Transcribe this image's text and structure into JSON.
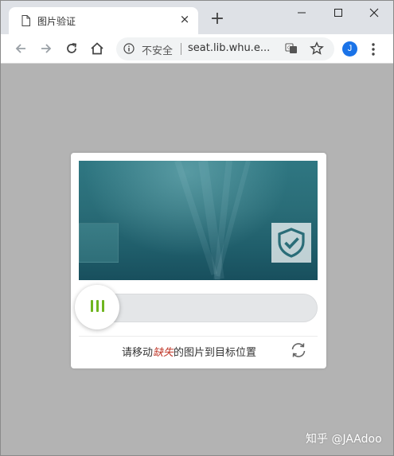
{
  "browser": {
    "tab_title": "图片验证",
    "tab_close": "×",
    "new_tab": "+",
    "window_controls": [
      "minimize-icon",
      "maximize-icon",
      "close-icon"
    ],
    "nav_icons": [
      "back-arrow-icon",
      "forward-arrow-icon",
      "reload-icon",
      "home-icon"
    ],
    "security_label": "不安全",
    "url": "seat.lib.whu.e...",
    "profile_initial": "J",
    "colors": {
      "profile": "#1a73e8",
      "tab_strip": "#dee1e6",
      "overlay": "#b3b3b3"
    }
  },
  "captcha": {
    "instruction_before": "请移动",
    "instruction_accent": "缺失",
    "instruction_after": "的图片到目标位置",
    "target_icon": "shield-check-icon",
    "handle_icon": "grip-bars-icon",
    "refresh_icon": "refresh-icon",
    "slider_progress": 0,
    "colors": {
      "grip": "#6fb51f",
      "accent_text": "#c0392b",
      "water": "#2a6d78"
    }
  },
  "watermark": "知乎 @JAAdoo"
}
